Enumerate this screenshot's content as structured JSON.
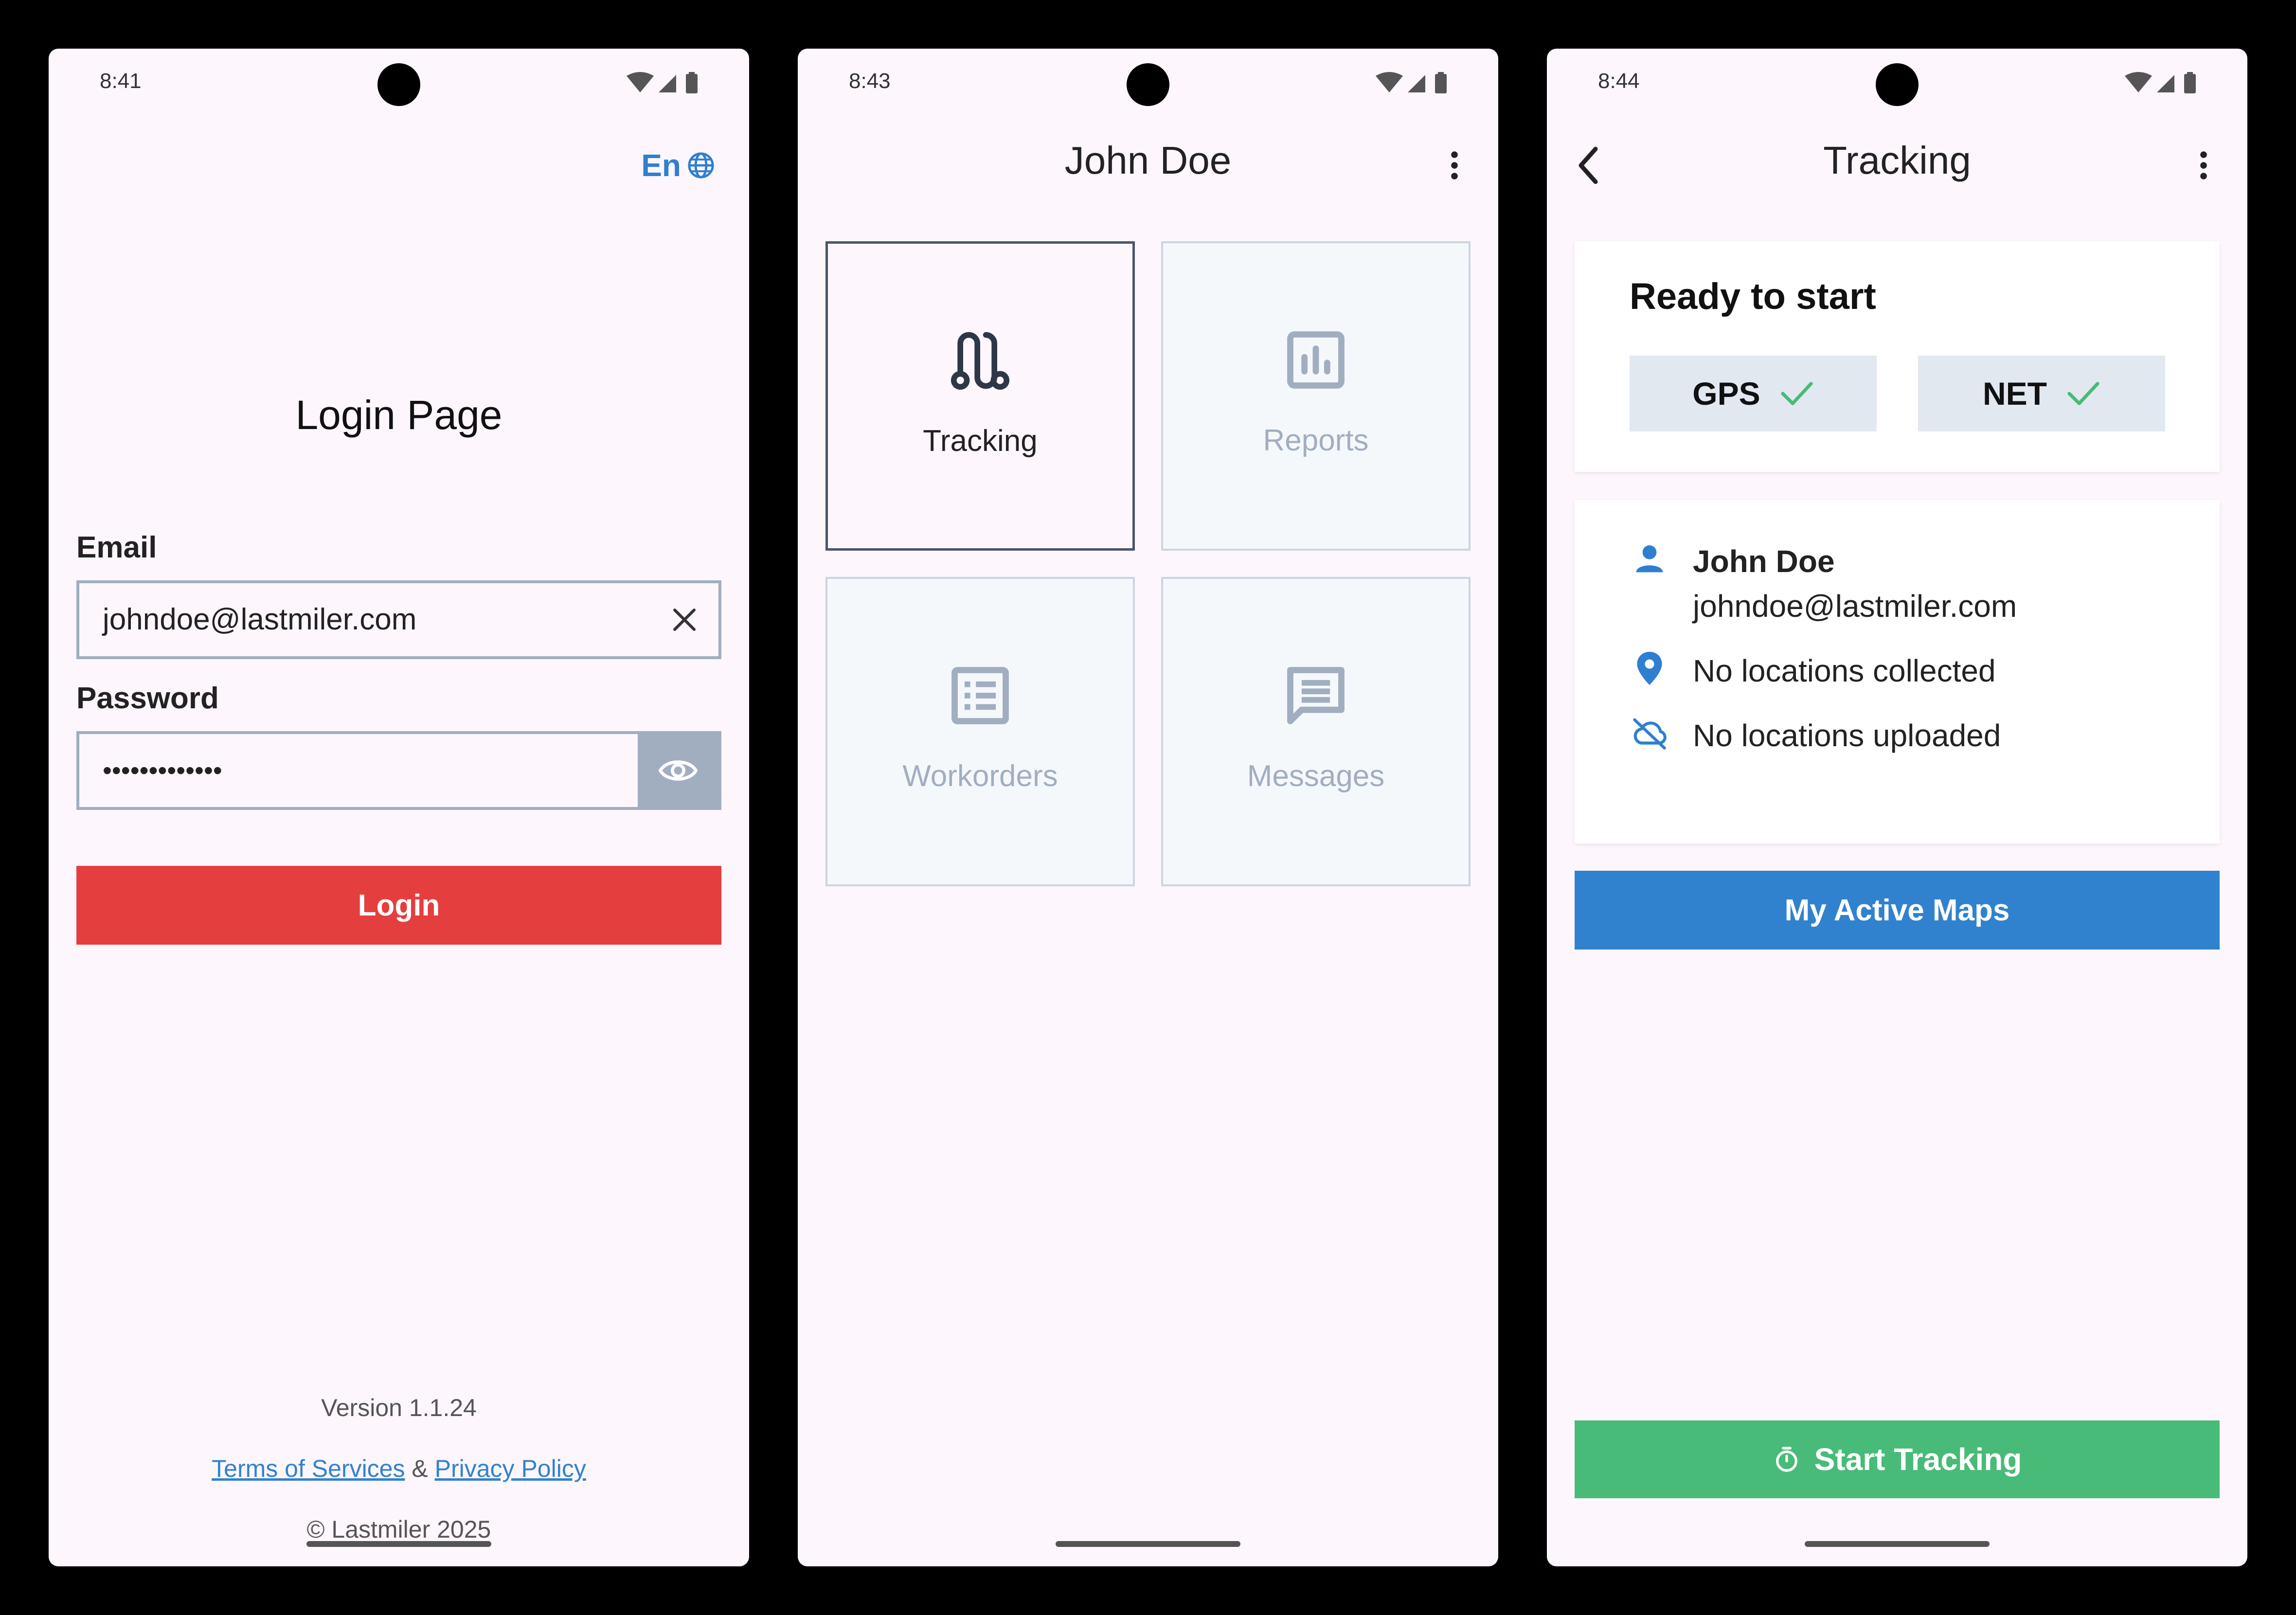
{
  "screens": {
    "login": {
      "status_time": "8:41",
      "language": "En",
      "title": "Login Page",
      "email_label": "Email",
      "email_value": "johndoe@lastmiler.com",
      "password_label": "Password",
      "password_value": "•••••••••••••",
      "login_label": "Login",
      "version": "Version 1.1.24",
      "terms_link": "Terms of Services",
      "amp": " & ",
      "privacy_link": "Privacy Policy",
      "copyright": "© Lastmiler 2025"
    },
    "home": {
      "status_time": "8:43",
      "title": "John Doe",
      "tiles": [
        {
          "label": "Tracking",
          "icon": "route-icon",
          "enabled": true
        },
        {
          "label": "Reports",
          "icon": "bar-chart-icon",
          "enabled": false
        },
        {
          "label": "Workorders",
          "icon": "list-icon",
          "enabled": false
        },
        {
          "label": "Messages",
          "icon": "message-icon",
          "enabled": false
        }
      ]
    },
    "tracking": {
      "status_time": "8:44",
      "title": "Tracking",
      "ready_title": "Ready to start",
      "chips": [
        {
          "label": "GPS",
          "icon": "check-icon"
        },
        {
          "label": "NET",
          "icon": "check-icon"
        }
      ],
      "user_name": "John Doe",
      "user_email": "johndoe@lastmiler.com",
      "locations_collected": "No locations collected",
      "locations_uploaded": "No locations uploaded",
      "active_maps_label": "My Active Maps",
      "start_label": "Start Tracking"
    }
  },
  "colors": {
    "screen_bg": "#fdf6fc",
    "link_blue": "#3182ce",
    "login_red": "#e53e3e",
    "start_green": "#48bb78",
    "check_green": "#48bb78",
    "disabled_gray": "#a0aec0"
  }
}
